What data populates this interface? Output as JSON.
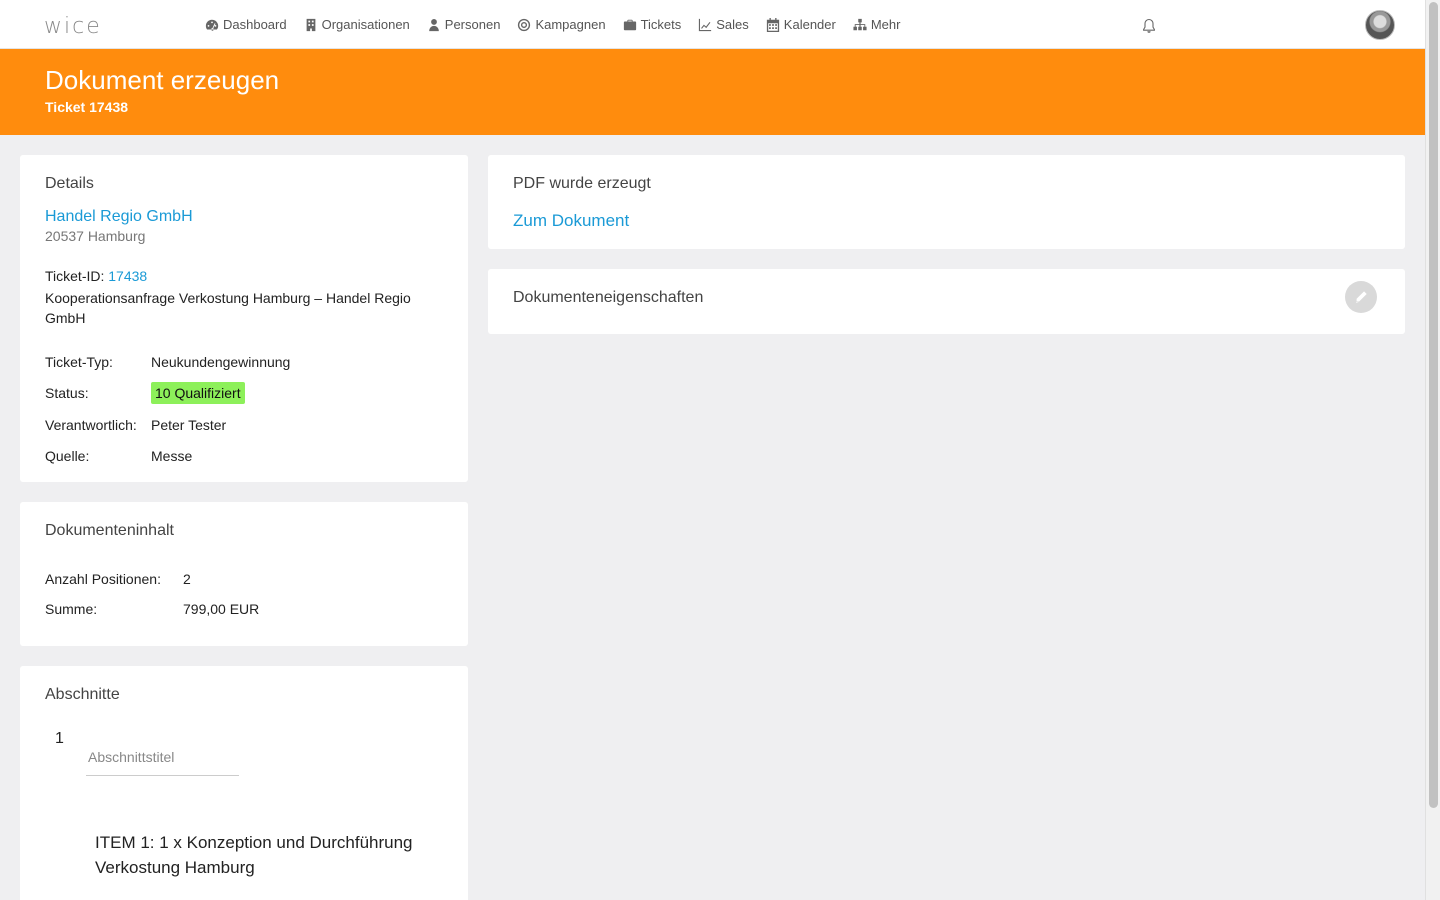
{
  "app": {
    "logo": "wice"
  },
  "nav": [
    {
      "label": "Dashboard",
      "icon": "dashboard-icon"
    },
    {
      "label": "Organisationen",
      "icon": "building-icon"
    },
    {
      "label": "Personen",
      "icon": "person-icon"
    },
    {
      "label": "Kampagnen",
      "icon": "target-icon"
    },
    {
      "label": "Tickets",
      "icon": "briefcase-icon"
    },
    {
      "label": "Sales",
      "icon": "chart-line-icon"
    },
    {
      "label": "Kalender",
      "icon": "calendar-icon"
    },
    {
      "label": "Mehr",
      "icon": "sitemap-icon"
    }
  ],
  "header": {
    "title": "Dokument erzeugen",
    "subtitle": "Ticket 17438"
  },
  "details": {
    "title": "Details",
    "company": "Handel Regio GmbH",
    "address": "20537 Hamburg",
    "ticket_id_label": "Ticket-ID:",
    "ticket_id": "17438",
    "ticket_subject": "Kooperationsanfrage Verkostung Hamburg – Handel Regio GmbH",
    "fields": {
      "type_label": "Ticket-Typ:",
      "type_value": "Neukundengewinnung",
      "status_label": "Status:",
      "status_value": "10 Qualifiziert",
      "owner_label": "Verantwortlich:",
      "owner_value": "Peter Tester",
      "source_label": "Quelle:",
      "source_value": "Messe"
    },
    "status_color": "#8df05a"
  },
  "content": {
    "title": "Dokumenteninhalt",
    "positions_label": "Anzahl Positionen:",
    "positions_value": "2",
    "sum_label": "Summe:",
    "sum_value": "799,00 EUR"
  },
  "sections": {
    "title": "Abschnitte",
    "number": "1",
    "placeholder": "Abschnittstitel",
    "item": "ITEM 1: 1 x Konzeption und Durchführung Verkostung Hamburg"
  },
  "pdf": {
    "title": "PDF wurde erzeugt",
    "link": "Zum Dokument"
  },
  "props": {
    "title": "Dokumenteneigenschaften",
    "edit_icon": "pencil-icon"
  },
  "colors": {
    "accent": "#ff8c0d",
    "link": "#1a9ad6"
  }
}
